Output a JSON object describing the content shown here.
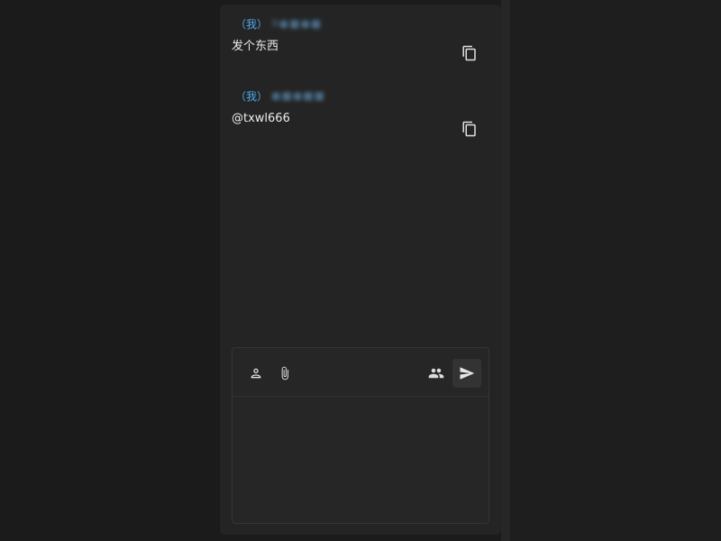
{
  "messages": [
    {
      "me_tag": "（我）",
      "sender": "9●■●■",
      "text": "发个东西",
      "copy_icon": "copy-icon"
    },
    {
      "me_tag": "（我）",
      "sender": "●■●■■",
      "text": "@txwl666",
      "copy_icon": "copy-icon"
    }
  ],
  "composer": {
    "input_value": "",
    "icons": [
      "mention-user-icon",
      "paperclip-icon",
      "group-icon",
      "send-icon"
    ]
  },
  "colors": {
    "me_tag": "#4fa7ea",
    "panel_bg": "#242424",
    "page_bg": "#1b1b1b"
  }
}
